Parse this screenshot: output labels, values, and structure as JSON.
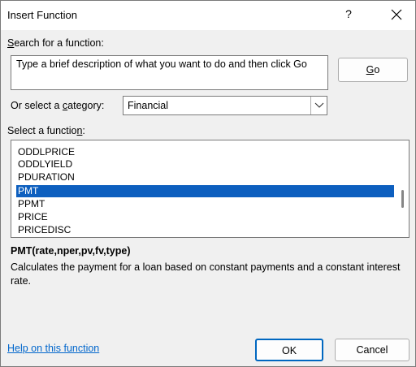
{
  "window": {
    "title": "Insert Function",
    "help_glyph": "?",
    "close_glyph": "close"
  },
  "search": {
    "label_prefix": "",
    "label_accel": "S",
    "label_rest": "earch for a function:",
    "value": "Type a brief description of what you want to do and then click Go",
    "go_accel": "G",
    "go_rest": "o"
  },
  "category": {
    "label_prefix": "Or select a ",
    "label_accel": "c",
    "label_rest": "ategory:",
    "selected": "Financial"
  },
  "functions": {
    "label_prefix": "Select a functio",
    "label_accel": "n",
    "label_rest": ":",
    "items": [
      "ODDLPRICE",
      "ODDLYIELD",
      "PDURATION",
      "PMT",
      "PPMT",
      "PRICE",
      "PRICEDISC"
    ],
    "selected_index": 3,
    "scroll_position": 0.5
  },
  "details": {
    "signature": "PMT(rate,nper,pv,fv,type)",
    "description": "Calculates the payment for a loan based on constant payments and a constant interest rate."
  },
  "footer": {
    "help_link": "Help on this function",
    "ok_label": "OK",
    "cancel_label": "Cancel"
  },
  "colors": {
    "selection": "#0d5fbf",
    "link": "#0066cc",
    "default_button_border": "#0067c0"
  }
}
